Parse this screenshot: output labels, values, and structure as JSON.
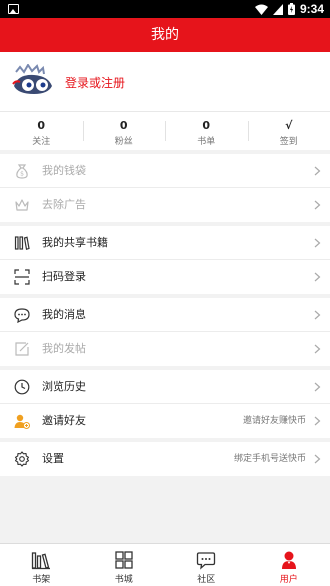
{
  "status_bar": {
    "time": "9:34"
  },
  "header": {
    "title": "我的"
  },
  "profile": {
    "login_label": "登录或注册"
  },
  "stats": [
    {
      "value": "0",
      "label": "关注"
    },
    {
      "value": "0",
      "label": "粉丝"
    },
    {
      "value": "0",
      "label": "书单"
    },
    {
      "value": "√",
      "label": "签到"
    }
  ],
  "menu": {
    "wallet": {
      "label": "我的钱袋"
    },
    "remove_ads": {
      "label": "去除广告"
    },
    "shared_books": {
      "label": "我的共享书籍"
    },
    "scan_login": {
      "label": "扫码登录"
    },
    "messages": {
      "label": "我的消息"
    },
    "my_posts": {
      "label": "我的发帖"
    },
    "history": {
      "label": "浏览历史"
    },
    "invite": {
      "label": "邀请好友",
      "hint": "邀请好友赚快币"
    },
    "settings": {
      "label": "设置",
      "hint": "绑定手机号送快币"
    }
  },
  "tabs": [
    {
      "label": "书架",
      "icon": "bookshelf-icon"
    },
    {
      "label": "书城",
      "icon": "grid-icon"
    },
    {
      "label": "社区",
      "icon": "chat-icon"
    },
    {
      "label": "用户",
      "icon": "user-icon",
      "active": true
    }
  ],
  "colors": {
    "accent": "#e6141b",
    "invite_icon": "#f0a020"
  }
}
